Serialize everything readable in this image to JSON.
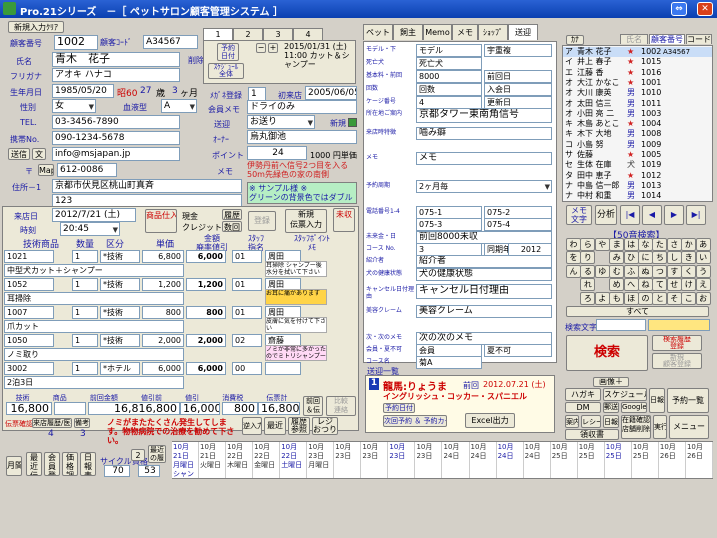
{
  "title": "Pro.21シリーズ　－［ ペットサロン顧客管理システム ］",
  "topbar": {
    "new_button": "新規入力ｸﾘｱ"
  },
  "customer": {
    "id_label": "顧客番号",
    "id": "1002",
    "code_label": "顧客ｺｰﾄﾞ",
    "code": "A34567",
    "name_label": "氏名",
    "name": "青木　花子",
    "death_label": "削除",
    "furigana_label": "フリガナ",
    "furigana": "アオキ ハナコ",
    "birth_label": "生年月日",
    "birth": "1985/05/20",
    "era": "昭60",
    "age": "27",
    "age_unit": "歳",
    "months": "3",
    "month_unit": "ヶ月",
    "sex_label": "性別",
    "sex": "女",
    "blood_label": "血液型",
    "blood": "A",
    "tel_label": "TEL.",
    "tel": "03-3456-7890",
    "mobile_label": "携帯No.",
    "mobile": "090-1234-5678",
    "send_btn": "送信",
    "mail_btn": "文",
    "email": "info@msjapan.jp",
    "zip_label": "〒",
    "zip": "612-0086",
    "map_btn": "Map",
    "addr_label": "住所－1",
    "addr1": "京都市伏見区桃山町真斉",
    "addr2": "123"
  },
  "mid": {
    "tabs": [
      "1",
      "2",
      "3",
      "4"
    ],
    "reserve_btn": "予約\n日付",
    "schedule_btn": "ｽｹｼﾞｭｰﾙ\n全体",
    "reserve_text": "2015/01/31 (土)\n11:00 カット＆シャンプー",
    "found_label": "ﾒｶﾞﾈ登録",
    "found": "1",
    "first_label": "初来店",
    "first": "2005/06/05",
    "member_label": "会員メモ",
    "member": "ドライのみ",
    "sendtype_label": "送迎",
    "sendtype": "お送り",
    "new_label": "新規",
    "otel_label": "ｵｰﾅｰ",
    "otel": "烏丸御池",
    "points_label": "ポイント",
    "points": "24",
    "points_val": "1000 円単価",
    "memo_label": "メモ",
    "memo_red": "伊勢丹前へ信号2つ目を入る50m先緑色の家の南側",
    "memo_green": "※ サンプル様 ※\nグリーンの背景色ではダブル"
  },
  "visit": {
    "date_label": "来店日",
    "date": "2012/7/21 (土)",
    "time_label": "時刻",
    "time": "20:45",
    "goods_btn": "商品仕入",
    "pay_label1": "現金",
    "pay_label2": "クレジット",
    "history_btn": "履歴",
    "history_btn2": "数回",
    "register_btn": "登録",
    "new_slip_btn": "新規\n伝票入力",
    "unpaid_btn": "未収",
    "headers": [
      "技術商品",
      "数量",
      "区分",
      "単価",
      "金額\n廃率値引",
      "ｽﾀｯﾌ\n指名",
      "ｽﾀｯﾌﾎﾟｲﾝﾄ\nﾒﾓ"
    ],
    "rows": [
      {
        "code": "1021",
        "qty": "1",
        "kind": "*技術",
        "price": "6,800",
        "amount": "6,000",
        "disc": "01",
        "staff": "",
        "name": "中型犬カット＋シャンプー",
        "memo": "周田"
      },
      {
        "code": "1052",
        "qty": "1",
        "kind": "*技術",
        "price": "1,200",
        "amount": "1,200",
        "disc": "01",
        "staff": "",
        "name": "耳掃除",
        "memo": "周田"
      },
      {
        "code": "1007",
        "qty": "1",
        "kind": "*技術",
        "price": "800",
        "amount": "800",
        "disc": "01",
        "staff": "",
        "name": "爪カット",
        "memo": "周田"
      },
      {
        "code": "1050",
        "qty": "1",
        "kind": "*技術",
        "price": "2,000",
        "amount": "2,000",
        "disc": "02",
        "staff": "",
        "name": "ノミ取り",
        "memo": "齋藤"
      },
      {
        "code": "3002",
        "qty": "1",
        "kind": "*ホテル",
        "price": "6,000",
        "amount": "6,000",
        "disc": "00",
        "staff": "",
        "name": "2泊3日",
        "memo": ""
      }
    ],
    "row_notes": [
      "耳掃除 シャンプー後水分を拭いて下さい",
      "お耳に痛があります",
      "皮膚に気を付けて下さい",
      "ノミが非常に多かったのでミトリシャンプー勧めろ"
    ],
    "total_labels": [
      "技術",
      "商品",
      "前回金額",
      "値引前",
      "値引",
      "消費税",
      "伝票計"
    ],
    "tech_total": "16,800",
    "goods_total": "",
    "prev": "",
    "subtotal": "16,816,800",
    "discount": "16,000",
    "tax": "800",
    "total": "16,800",
    "prev_btn": "前回\n＆伝票",
    "next_btn": "比較\n連絡",
    "hist_label": "伝票確認Z",
    "hist_btns": [
      "来店履歴/医療",
      "備考"
    ],
    "hist_nums": [
      "4",
      "3"
    ],
    "red_note": "ノミがまたたくさん発生してします。物物病院での治療を勧めて下さい。",
    "reverse_btn": "逆入力",
    "recent_btn": "最近",
    "history2_btn": "履歴\n参照",
    "register2_btn": "レジ\nおつり"
  },
  "bottom": {
    "btns": [
      "月間",
      "最近\n伝票",
      "会員\n登録",
      "価格\n調整",
      "日報\n表示"
    ],
    "cycle_label": "サイクル",
    "cycle": "70",
    "cycle2_label": "資格～",
    "cycle2": "53",
    "page": "2",
    "page2": "最近\nの履歴"
  },
  "pettabs": {
    "tabs": [
      "ペット",
      "飼主",
      "Memo",
      "メモ",
      "ｼｮｯﾌﾟ",
      "送迎"
    ],
    "fields": [
      {
        "label": "モデル・下",
        "value": "モデル",
        "value2": "宇重複"
      },
      {
        "label": "死亡犬",
        "value": "死亡犬",
        "value2": ""
      },
      {
        "label": "基本料・前回",
        "value": "8000",
        "value2": "前回日"
      },
      {
        "label": "回数",
        "value": "回数",
        "value2": "入会日"
      },
      {
        "label": "ケージ番号",
        "value": "4",
        "value2": "更新日"
      },
      {
        "label": "所在地ご案内",
        "value": "京都タワー東南角信号",
        "value2": ""
      },
      {
        "label": "来店時特徴",
        "value": "嚙み癖",
        "value2": ""
      },
      {
        "label": "メモ",
        "value": "メモ",
        "value2": ""
      },
      {
        "label": "予約周期",
        "value": "2ヶ月毎",
        "value2": ""
      },
      {
        "label": "電話番号1-4",
        "value": "075-1",
        "value2": "075-2"
      },
      {
        "label": "",
        "value": "075-3",
        "value2": "075-4"
      },
      {
        "label": "未来金・日",
        "value": "前回8000未収",
        "value2": ""
      },
      {
        "label": "コース No.",
        "value": "3",
        "value2": "同期年度",
        "value3": "2012"
      },
      {
        "label": "紹介者",
        "value": "紹介者",
        "value2": ""
      },
      {
        "label": "犬の健康状態",
        "value": "犬の健康状態",
        "value2": ""
      },
      {
        "label": "キャンセル日付理由",
        "value": "キャンセル日付理由",
        "value2": ""
      },
      {
        "label": "美容クレーム",
        "value": "美容クレーム",
        "value2": ""
      },
      {
        "label": "次・次のメモ",
        "value": "次の次のメモ",
        "value2": ""
      },
      {
        "label": "会員・夏不可",
        "value": "会員",
        "value2": "夏不可"
      },
      {
        "label": "コース名",
        "value": "菊A",
        "value2": ""
      }
    ],
    "list_label": "送迎一覧",
    "pet_no": "1",
    "pet_name": "龍馬:りょうま",
    "pet_visit_label": "前回",
    "pet_visit": "2012.07.21 (土)",
    "pet_breed": "イングリッシュ・コッカー・スパニエル",
    "pet_btn1": "予約日付",
    "pet_btn2": "次回予約 ＆ 予約カード",
    "excel_btn": "Excel出力"
  },
  "right": {
    "search_btn": "ｶﾅ",
    "tabs": [
      "氏名",
      "顧客番号",
      "コード"
    ],
    "list": [
      {
        "kana": "ア",
        "name": "青木 花子",
        "sex": "★",
        "no": "1002",
        "code": "A34567"
      },
      {
        "kana": "イ",
        "name": "井上 春子",
        "sex": "★",
        "no": "1015",
        "code": ""
      },
      {
        "kana": "エ",
        "name": "江藤 香",
        "sex": "★",
        "no": "1016",
        "code": ""
      },
      {
        "kana": "オ",
        "name": "大江 かなこ",
        "sex": "★",
        "no": "1001",
        "code": ""
      },
      {
        "kana": "オ",
        "name": "大川 康英",
        "sex": "男",
        "no": "1010",
        "code": ""
      },
      {
        "kana": "オ",
        "name": "太田 信三",
        "sex": "男",
        "no": "1011",
        "code": ""
      },
      {
        "kana": "オ",
        "name": "小田 亮 二",
        "sex": "男",
        "no": "1003",
        "code": ""
      },
      {
        "kana": "キ",
        "name": "木島 あとこ",
        "sex": "★",
        "no": "1004",
        "code": ""
      },
      {
        "kana": "キ",
        "name": "木下 大地",
        "sex": "男",
        "no": "1008",
        "code": ""
      },
      {
        "kana": "コ",
        "name": "小島 努",
        "sex": "男",
        "no": "1009",
        "code": ""
      },
      {
        "kana": "サ",
        "name": "佐藤",
        "sex": "★",
        "no": "1005",
        "code": ""
      },
      {
        "kana": "セ",
        "name": "生体 在庫",
        "sex": "犬",
        "no": "1019",
        "code": ""
      },
      {
        "kana": "タ",
        "name": "田中 恵子",
        "sex": "★",
        "no": "1012",
        "code": ""
      },
      {
        "kana": "ナ",
        "name": "中島 信一郎",
        "sex": "男",
        "no": "1013",
        "code": ""
      },
      {
        "kana": "ナ",
        "name": "中村 和重",
        "sex": "男",
        "no": "1014",
        "code": ""
      }
    ],
    "nav_memo": "メモ\n文字",
    "nav_split": "分析",
    "nav": [
      "|◀",
      "◀",
      "▶",
      "▶|"
    ],
    "kana_title": "【50音検索】",
    "kana": [
      "わ",
      "ら",
      "や",
      "ま",
      "は",
      "な",
      "た",
      "さ",
      "か",
      "あ",
      "を",
      "り",
      "",
      "み",
      "ひ",
      "に",
      "ち",
      "し",
      "き",
      "い",
      "ん",
      "る",
      "ゆ",
      "む",
      "ふ",
      "ぬ",
      "つ",
      "す",
      "く",
      "う",
      "",
      "れ",
      "",
      "め",
      "へ",
      "ね",
      "て",
      "せ",
      "け",
      "え",
      "",
      "ろ",
      "よ",
      "も",
      "ほ",
      "の",
      "と",
      "そ",
      "こ",
      "お"
    ],
    "all_btn": "すべて",
    "search_text_label": "検索文字",
    "search_btn2": "検索",
    "history_search": "検索履歴\n登録",
    "new_search": "新規\n顧客登録",
    "btn_rows": [
      [
        "画像＋"
      ],
      [
        "ハガキ",
        "スケジュール",
        "日報",
        "予約一覧"
      ],
      [
        "DM",
        "郵送",
        "Google"
      ],
      [
        "案内",
        "レシート",
        "日報",
        "在籍確認\n店舗削除",
        "実行",
        "メニュー"
      ],
      [
        "領収書"
      ]
    ]
  },
  "bottom_bar": {
    "cols": [
      "10月21日\n月曜日\nシャンプー",
      "10月21日\n火曜日",
      "10月22日\n木曜日",
      "10月22日\n金曜日",
      "10月22日\n土曜日",
      "10月23日\n月曜日",
      "10月23日",
      "10月23日",
      "10月23日",
      "10月23日",
      "10月24日",
      "10月24日",
      "10月24日",
      "10月24日",
      "10月25日",
      "10月25日",
      "10月25日",
      "10月25日",
      "10月26日",
      "10月26日"
    ]
  }
}
